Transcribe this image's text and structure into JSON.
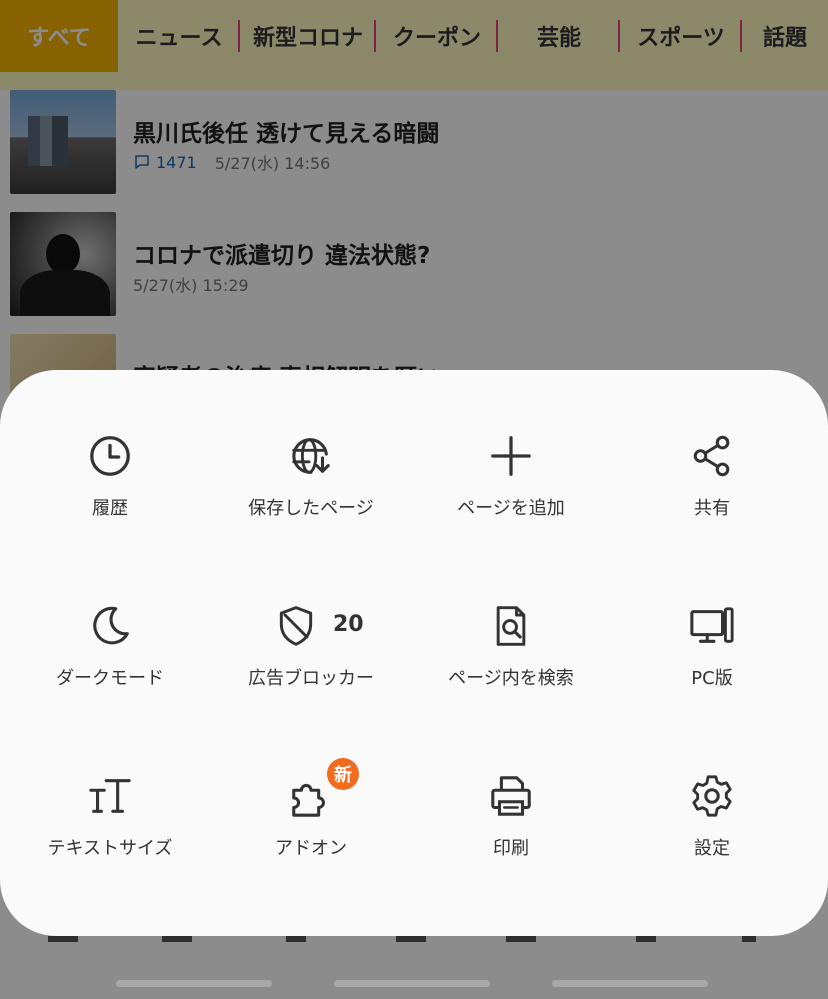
{
  "categories": [
    {
      "label": "すべて",
      "active": true
    },
    {
      "label": "ニュース"
    },
    {
      "label": "新型コロナ"
    },
    {
      "label": "クーポン"
    },
    {
      "label": "芸能"
    },
    {
      "label": "スポーツ"
    },
    {
      "label": "話題"
    }
  ],
  "articles": [
    {
      "title": "黒川氏後任 透けて見える暗闘",
      "comments": "1471",
      "time": "5/27(水) 14:56"
    },
    {
      "title": "コロナで派遣切り 違法状態?",
      "time": "5/27(水) 15:29"
    },
    {
      "title": "容疑者の治療 真相解明を願い"
    }
  ],
  "menu": {
    "history": {
      "label": "履歴",
      "icon": "clock-icon"
    },
    "saved_pages": {
      "label": "保存したページ",
      "icon": "globe-download-icon"
    },
    "add_page": {
      "label": "ページを追加",
      "icon": "plus-icon"
    },
    "share": {
      "label": "共有",
      "icon": "share-icon"
    },
    "dark_mode": {
      "label": "ダークモード",
      "icon": "moon-icon"
    },
    "ad_blocker": {
      "label": "広告ブロッカー",
      "icon": "shield-icon",
      "count": "20"
    },
    "find_in_page": {
      "label": "ページ内を検索",
      "icon": "find-in-page-icon"
    },
    "pc_version": {
      "label": "PC版",
      "icon": "desktop-icon"
    },
    "text_size": {
      "label": "テキストサイズ",
      "icon": "text-size-icon"
    },
    "addons": {
      "label": "アドオン",
      "icon": "puzzle-icon",
      "badge": "新"
    },
    "print": {
      "label": "印刷",
      "icon": "printer-icon"
    },
    "settings": {
      "label": "設定",
      "icon": "gear-icon"
    }
  },
  "colors": {
    "category_active_bg": "#f4b400",
    "category_bar_bg": "#fff9c4",
    "category_separator": "#e0457b",
    "comment_blue": "#1e66b3",
    "new_badge": "#f26b1d",
    "sheet_bg": "#fafafa",
    "icon_color": "#333333"
  }
}
